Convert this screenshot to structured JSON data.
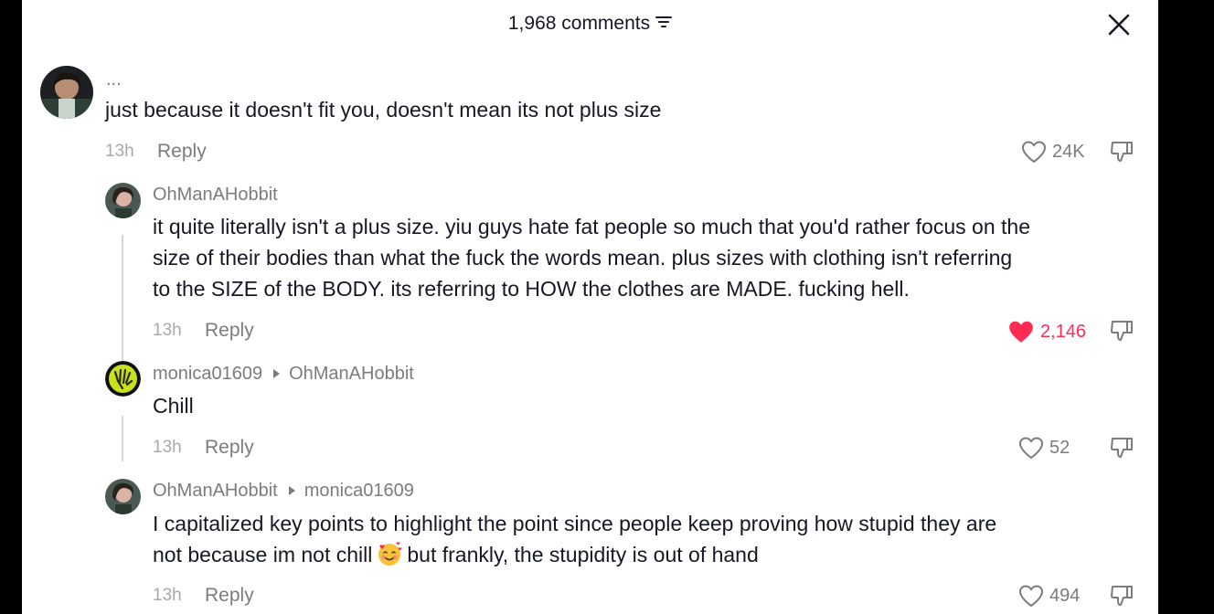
{
  "header": {
    "title": "1,968 comments",
    "close_icon": "close-icon",
    "sort_icon": "sort-icon"
  },
  "colors": {
    "liked": "#fe2c55",
    "muted": "#7b7b80",
    "text": "#161823",
    "divider": "#d6d6d9"
  },
  "comments": [
    {
      "username": "...",
      "text": "just because it doesn't fit you, doesn't mean its not plus size",
      "time": "13h",
      "reply": "Reply",
      "likes": "24K",
      "liked": false
    },
    {
      "username": "OhManAHobbit",
      "text_lines": [
        "it quite literally isn't a plus size. yiu guys hate fat people so much that you'd rather focus on the",
        "size of their bodies than what the fuck the words mean. plus sizes with clothing isn't referring",
        "to the SIZE of the BODY. its referring to HOW the clothes are MADE. fucking hell."
      ],
      "time": "13h",
      "reply": "Reply",
      "likes": "2,146",
      "liked": true
    },
    {
      "username": "monica01609",
      "reply_to": "OhManAHobbit",
      "text": "Chill",
      "time": "13h",
      "reply": "Reply",
      "likes": "52",
      "liked": false
    },
    {
      "username": "OhManAHobbit",
      "reply_to": "monica01609",
      "text_line1": "I capitalized key points to highlight the point since people keep proving how stupid they are",
      "text_line2_a": "not because im not chill",
      "text_line2_b": "but frankly, the stupidity is out of hand",
      "emoji": "smiling-face-with-hearts",
      "time": "13h",
      "reply": "Reply",
      "likes": "494",
      "liked": false
    }
  ]
}
